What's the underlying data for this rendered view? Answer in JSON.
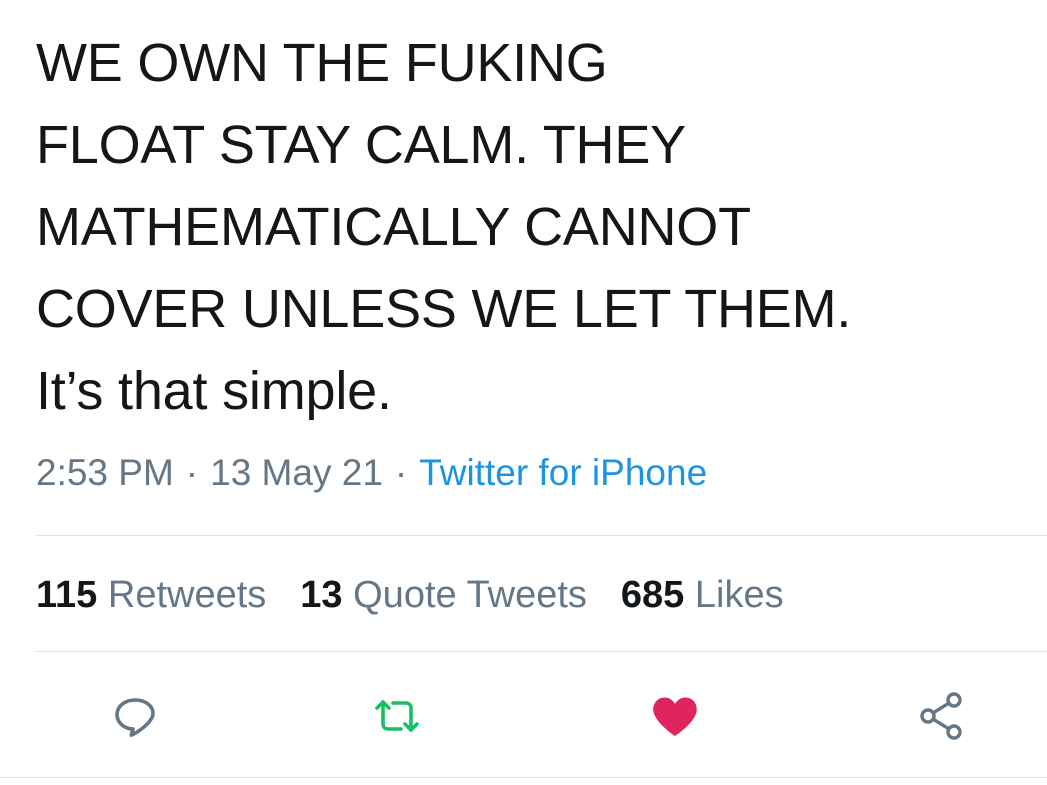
{
  "tweet": {
    "lines": [
      "WE OWN THE FUKING",
      "FLOAT STAY CALM. THEY",
      "MATHEMATICALLY CANNOT",
      "COVER UNLESS WE LET THEM.",
      "It’s that simple."
    ],
    "time": "2:53 PM",
    "date": "13 May 21",
    "separator": "·",
    "source": "Twitter for iPhone"
  },
  "stats": {
    "retweets": {
      "count": "115",
      "label": "Retweets"
    },
    "quotes": {
      "count": "13",
      "label": "Quote Tweets"
    },
    "likes": {
      "count": "685",
      "label": "Likes"
    }
  },
  "actions": {
    "reply": {
      "icon": "reply-icon",
      "color": "#657786"
    },
    "retweet": {
      "icon": "retweet-icon",
      "color": "#17bf63"
    },
    "like": {
      "icon": "heart-icon",
      "color": "#e0245e",
      "liked": true
    },
    "share": {
      "icon": "share-icon",
      "color": "#657786"
    }
  }
}
